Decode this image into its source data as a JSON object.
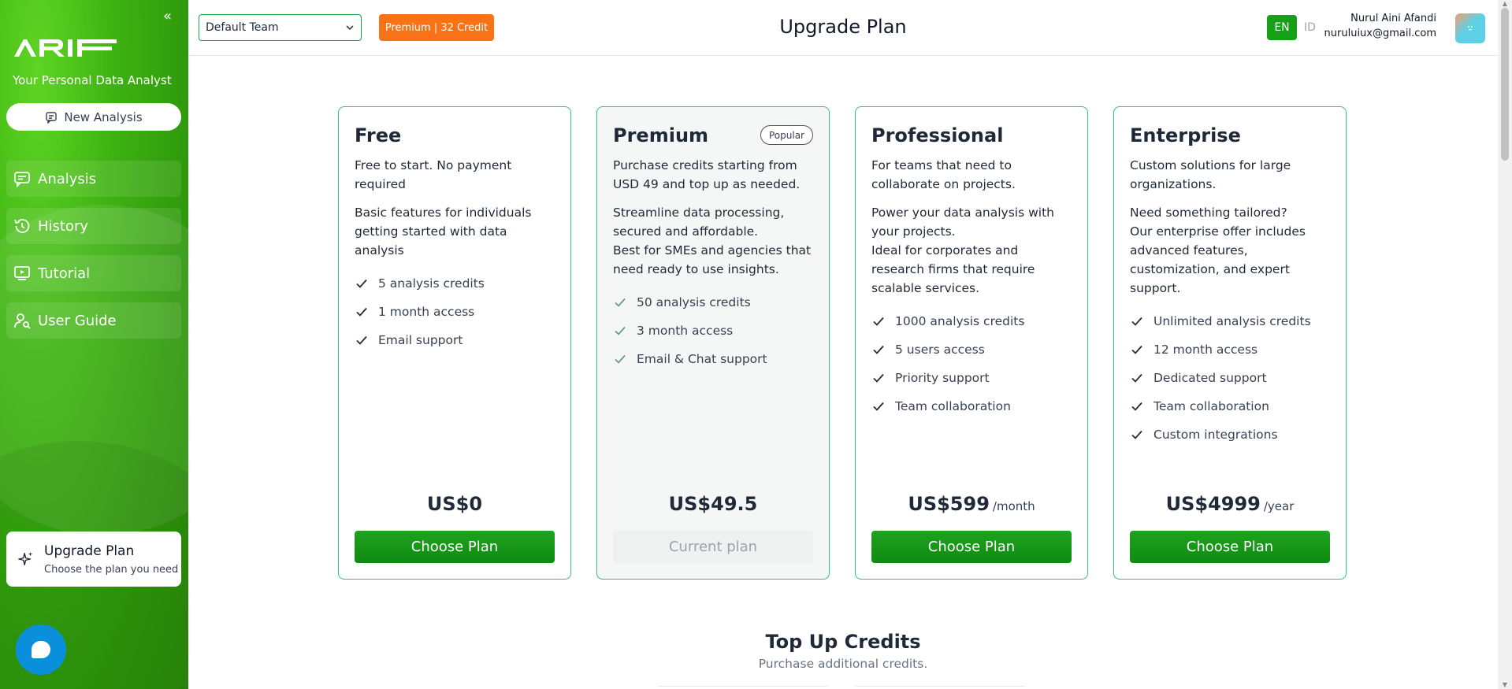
{
  "sidebar": {
    "collapse_icon": "«",
    "logo_text": "ARIF",
    "tagline": "Your Personal Data Analyst",
    "new_analysis_label": "New Analysis",
    "items": [
      {
        "label": "Analysis",
        "icon": "chat-icon"
      },
      {
        "label": "History",
        "icon": "history-icon"
      },
      {
        "label": "Tutorial",
        "icon": "video-icon"
      },
      {
        "label": "User Guide",
        "icon": "user-search-icon"
      }
    ],
    "upgrade": {
      "title": "Upgrade Plan",
      "subtitle": "Choose the plan you need"
    }
  },
  "header": {
    "team_select_value": "Default Team",
    "credit_badge": "Premium | 32 Credit",
    "title": "Upgrade Plan",
    "lang_en": "EN",
    "lang_id": "ID",
    "user_name": "Nurul Aini Afandi",
    "user_email": "nuruluiux@gmail.com"
  },
  "plans": [
    {
      "name": "Free",
      "desc": [
        "Free to start. No payment required",
        "Basic features for individuals getting started with data analysis"
      ],
      "features": [
        "5 analysis credits",
        "1 month access",
        "Email support"
      ],
      "price": "US$0",
      "period": "",
      "button": "Choose Plan"
    },
    {
      "name": "Premium",
      "badge": "Popular",
      "desc": [
        "Purchase credits starting from USD 49 and top up as needed.",
        "Streamline data processing, secured and affordable.",
        "Best for SMEs and agencies that need ready to use insights."
      ],
      "features": [
        "50 analysis credits",
        "3 month access",
        "Email & Chat support"
      ],
      "price": "US$49.5",
      "period": "",
      "button": "Current plan"
    },
    {
      "name": "Professional",
      "desc": [
        "For teams that need to collaborate on projects.",
        "Power your data analysis with your projects.",
        "Ideal for corporates and research firms that require scalable services."
      ],
      "features": [
        "1000 analysis credits",
        "5 users access",
        "Priority support",
        "Team collaboration"
      ],
      "price": "US$599",
      "period": "/month",
      "button": "Choose Plan"
    },
    {
      "name": "Enterprise",
      "desc": [
        "Custom solutions for large organizations.",
        "Need something tailored?",
        "Our enterprise offer includes advanced features, customization, and expert support."
      ],
      "features": [
        "Unlimited analysis credits",
        "12 month access",
        "Dedicated support",
        "Team collaboration",
        "Custom integrations"
      ],
      "price": "US$4999",
      "period": "/year",
      "button": "Choose Plan"
    }
  ],
  "topup": {
    "title": "Top Up Credits",
    "subtitle": "Purchase additional credits."
  },
  "colors": {
    "brand_green": "#15a015",
    "card_border": "#34c178",
    "credit_orange": "#f97316",
    "chat_blue": "#0a8fdc"
  }
}
